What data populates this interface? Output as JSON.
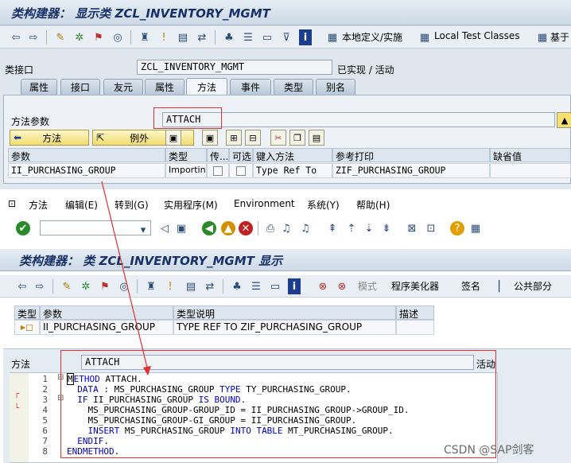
{
  "window1": {
    "title": "类构建器： 显示类 ZCL_INVENTORY_MGMT",
    "toolbar": {
      "local_def": "本地定义/实施",
      "local_test": "Local Test Classes",
      "base": "基于"
    },
    "class_interface_label": "类接口",
    "class_interface_value": "ZCL_INVENTORY_MGMT",
    "status": "已实现 / 活动",
    "tabs": [
      "属性",
      "接口",
      "友元",
      "属性",
      "方法",
      "事件",
      "类型",
      "别名"
    ],
    "method_params_label": "方法参数",
    "method_params_value": "ATTACH",
    "btn_method": "方法",
    "btn_exception": "例外",
    "table": {
      "headers": [
        "参数",
        "类型",
        "传...",
        "可选",
        "键入方法",
        "参考打印",
        "缺省值"
      ],
      "row": [
        "II_PURCHASING_GROUP",
        "Importin...",
        "",
        "",
        "Type Ref To",
        "ZIF_PURCHASING_GROUP",
        ""
      ]
    }
  },
  "window2": {
    "menu": [
      "方法",
      "编辑(E)",
      "转到(G)",
      "实用程序(M)",
      "Environment",
      "系统(Y)",
      "帮助(H)"
    ],
    "title": "类构建器： 类 ZCL_INVENTORY_MGMT 显示",
    "toolbar": {
      "pattern": "模式",
      "pretty": "程序美化器",
      "sign": "签名",
      "public": "公共部分"
    },
    "param_table": {
      "headers": [
        "类型",
        "参数",
        "类型说明",
        "描述"
      ],
      "row": [
        "",
        "II_PURCHASING_GROUP",
        "TYPE REF TO ZIF_PURCHASING_GROUP",
        ""
      ]
    },
    "method_label": "方法",
    "method_value": "ATTACH",
    "method_status": "活动",
    "code_lines": [
      "1",
      "2",
      "3",
      "4",
      "5",
      "6",
      "7",
      "8"
    ]
  },
  "watermark": "CSDN @SAP剑客",
  "colors": {
    "title": "#17306a",
    "keyword": "#0000c8",
    "highlight": "#e03030"
  }
}
